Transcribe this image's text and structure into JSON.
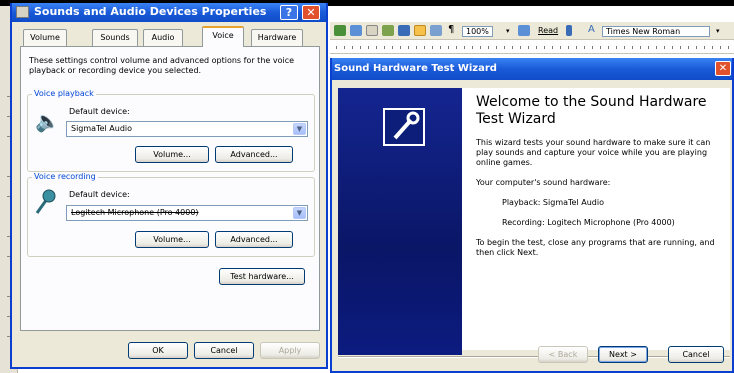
{
  "dialog": {
    "title": "Sounds and Audio Devices Properties",
    "help_glyph": "?",
    "close_glyph": "✕",
    "tabs": [
      "Volume",
      "Sounds",
      "Audio",
      "Voice",
      "Hardware"
    ],
    "active_tab": "Voice",
    "intro_line1": "These settings control volume and advanced options for the voice",
    "intro_line2": "playback or recording device you selected.",
    "playback": {
      "group_label": "Voice playback",
      "device_label": "Default device:",
      "device_value": "SigmaTel Audio",
      "volume_button": "Volume...",
      "advanced_button": "Advanced..."
    },
    "recording": {
      "group_label": "Voice recording",
      "device_label": "Default device:",
      "device_value": "Logitech Microphone (Pro 4000)",
      "volume_button": "Volume...",
      "advanced_button": "Advanced..."
    },
    "test_hardware_button": "Test hardware...",
    "ok_button": "OK",
    "cancel_button": "Cancel",
    "apply_button": "Apply"
  },
  "word_toolbar": {
    "zoom": "100%",
    "read_button": "Read",
    "font_name": "Times New Roman"
  },
  "wizard": {
    "title": "Sound Hardware Test Wizard",
    "close_glyph": "✕",
    "heading_line1": "Welcome to the Sound Hardware",
    "heading_line2": "Test Wizard",
    "desc_line1": "This wizard tests your sound hardware to make sure it can",
    "desc_line2": "play sounds and capture your voice while you are playing",
    "desc_line3": "online games.",
    "hw_label": "Your computer's sound hardware:",
    "playback_line": "Playback:  SigmaTel Audio",
    "recording_line": "Recording:  Logitech Microphone (Pro 4000)",
    "begin_line1": "To begin the test, close any programs that are running, and",
    "begin_line2": "then click Next.",
    "back_button": "< Back",
    "next_button": "Next >",
    "cancel_button": "Cancel"
  },
  "colors": {
    "titlebar": "#1a5ad8",
    "group_label": "#0046d5",
    "wizard_panel": "#0c1d7a",
    "close_red": "#e0512c"
  }
}
